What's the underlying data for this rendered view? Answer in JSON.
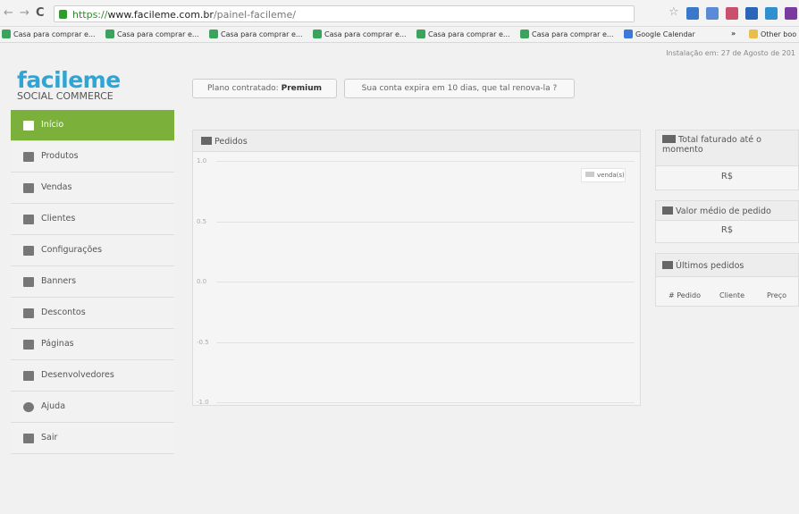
{
  "browser": {
    "url_scheme": "https://",
    "url_domain": "www.facileme.com.br",
    "url_path": "/painel-facileme/",
    "bookmarks": [
      "Casa para comprar e...",
      "Casa para comprar e...",
      "Casa para comprar e...",
      "Casa para comprar e...",
      "Casa para comprar e...",
      "Casa para comprar e...",
      "Google Calendar"
    ],
    "bookmarks_overflow": "»",
    "other_bookmarks": "Other boo"
  },
  "header": {
    "install_date": "Instalação em: 27 de Agosto de 201",
    "logo_main": "facileme",
    "logo_sub": "SOCIAL COMMERCE",
    "plan_label": "Plano contratado:",
    "plan_value": "Premium",
    "expire_message": "Sua conta expira em 10 dias, que tal renova-la ?"
  },
  "sidebar": {
    "items": [
      {
        "label": "Início",
        "icon": "home-icon"
      },
      {
        "label": "Produtos",
        "icon": "folder-icon"
      },
      {
        "label": "Vendas",
        "icon": "cart-icon"
      },
      {
        "label": "Clientes",
        "icon": "users-icon"
      },
      {
        "label": "Configurações",
        "icon": "gears-icon"
      },
      {
        "label": "Banners",
        "icon": "banner-icon"
      },
      {
        "label": "Descontos",
        "icon": "tag-icon"
      },
      {
        "label": "Páginas",
        "icon": "page-icon"
      },
      {
        "label": "Desenvolvedores",
        "icon": "developer-icon"
      },
      {
        "label": "Ajuda",
        "icon": "help-icon"
      },
      {
        "label": "Sair",
        "icon": "logout-icon"
      }
    ],
    "active_index": 0
  },
  "orders_panel": {
    "title": "Pedidos",
    "icon": "line-chart-icon"
  },
  "chart_data": {
    "type": "line",
    "title": "Pedidos",
    "series": [
      {
        "name": "venda(s)",
        "values": []
      }
    ],
    "y_ticks": [
      "1.0",
      "0.5",
      "0.0",
      "-0.5",
      "-1.0"
    ],
    "ylim": [
      -1.0,
      1.0
    ],
    "grid": true,
    "legend_position": "top-right"
  },
  "total_panel": {
    "title": "Total faturado até o momento",
    "value": "R$",
    "icon": "money-icon"
  },
  "average_panel": {
    "title": "Valor médio de pedido",
    "value": "R$",
    "icon": "coins-icon"
  },
  "latest_orders": {
    "title": "Últimos pedidos",
    "icon": "cart-icon",
    "columns": [
      "# Pedido",
      "Cliente",
      "Preço"
    ]
  },
  "colors": {
    "brand": "#2fa5d6",
    "active_nav": "#7bb13a"
  }
}
